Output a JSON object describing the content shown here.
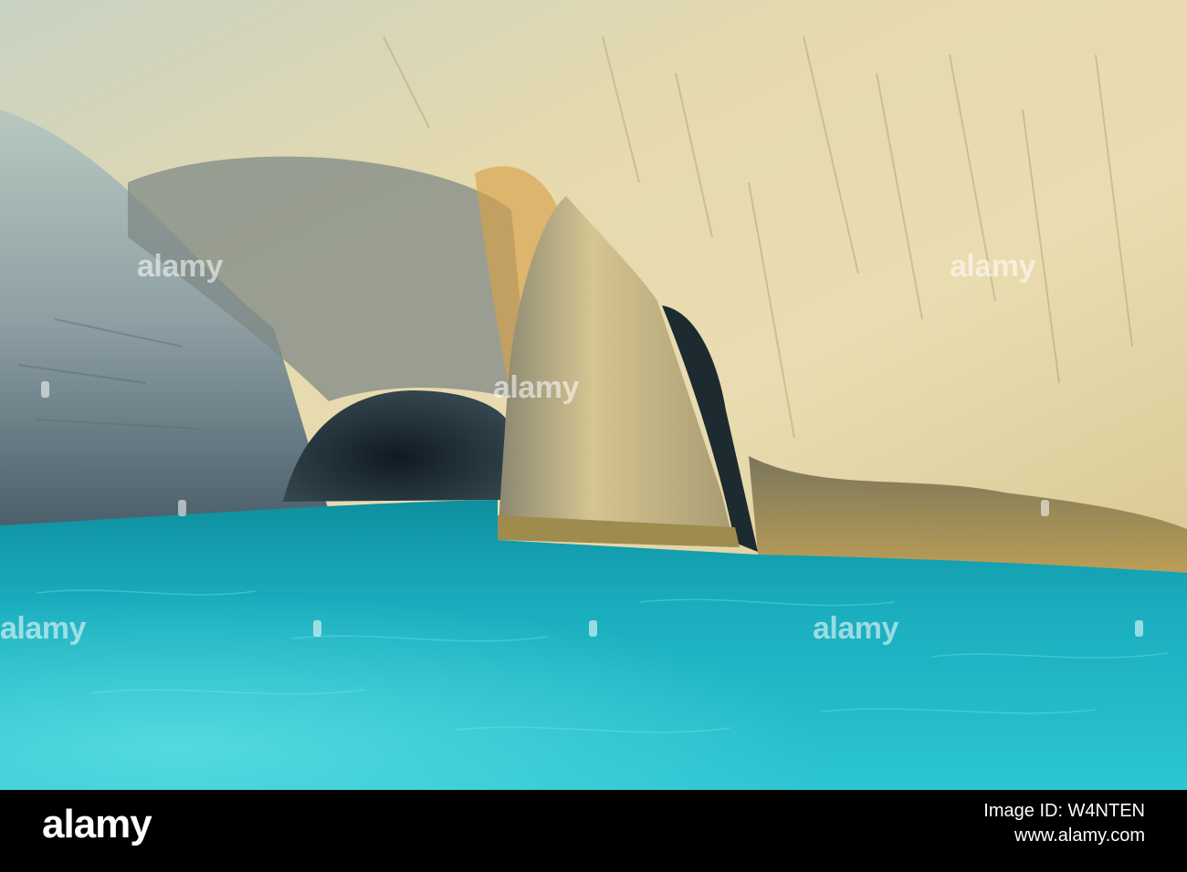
{
  "photo": {
    "watermark_text": "alamy",
    "colors": {
      "water_light": "#33d3dc",
      "water_mid": "#1bb2c2",
      "water_dark": "#0c8a9c",
      "rock_light": "#e9dcb0",
      "rock_warm": "#d9b46a",
      "rock_cool": "#9fb2a8",
      "cave_dark": "#1c2a33"
    }
  },
  "footer": {
    "logo_text": "alamy",
    "image_id_line": "Image ID: W4NTEN",
    "site_line": "www.alamy.com"
  }
}
